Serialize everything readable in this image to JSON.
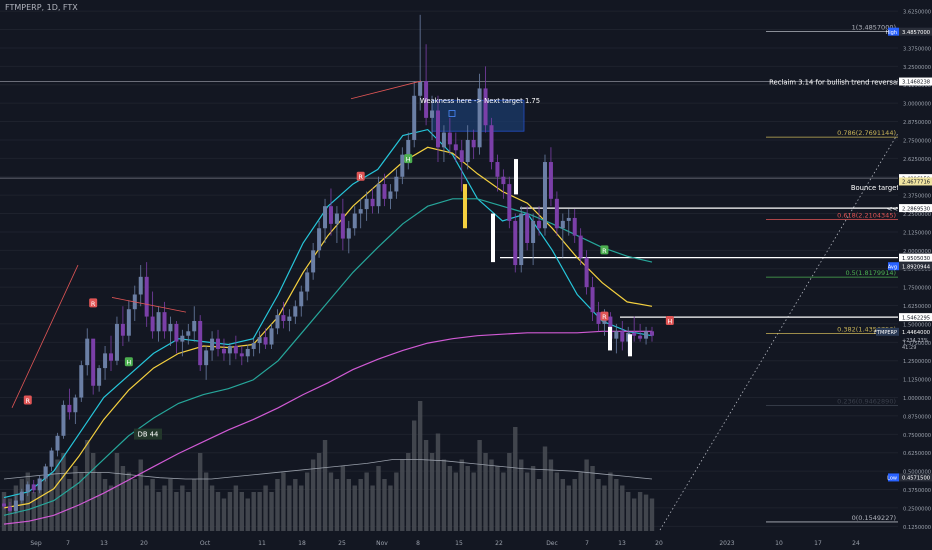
{
  "header": {
    "symbol": "FTMPERP, 1D, FTX"
  },
  "chart_data": {
    "type": "candlestick",
    "symbol": "FTMPERP",
    "interval": "1D",
    "exchange": "FTX",
    "x_labels": [
      "Sep",
      "7",
      "13",
      "20",
      "Oct",
      "11",
      "18",
      "25",
      "Nov",
      "8",
      "15",
      "22",
      "Dec",
      "7",
      "13",
      "20",
      "2023",
      "10",
      "17",
      "24"
    ],
    "y_ticks": [
      "3.6250000",
      "3.5000000",
      "3.3750000",
      "3.2500000",
      "3.1250000",
      "3.0000000",
      "2.8750000",
      "2.7500000",
      "2.6250000",
      "2.5000000",
      "2.3750000",
      "2.2500000",
      "2.1250000",
      "2.0000000",
      "1.8750000",
      "1.7500000",
      "1.6250000",
      "1.5000000",
      "1.3750000",
      "1.2500000",
      "1.1250000",
      "1.0000000",
      "0.8750000",
      "0.7500000",
      "0.6250000",
      "0.5000000",
      "0.3750000",
      "0.2500000",
      "0.1250000"
    ],
    "ylim": [
      0.1,
      3.66
    ],
    "price_tags": [
      {
        "text": "3.4857000",
        "price": 3.4857,
        "color": "#ffffff",
        "bg": "#2a2e39"
      },
      {
        "text": "3.1468238",
        "price": 3.1468,
        "color": "#131722",
        "bg": "#ffffff"
      },
      {
        "text": "2.4906159",
        "price": 2.4906,
        "color": "#131722",
        "bg": "#ffffff"
      },
      {
        "text": "2.4677716",
        "price": 2.4678,
        "color": "#131722",
        "bg": "#f0e4a0"
      },
      {
        "text": "2.2869530",
        "price": 2.287,
        "color": "#131722",
        "bg": "#ffffff"
      },
      {
        "text": "1.9505030",
        "price": 1.9505,
        "color": "#131722",
        "bg": "#ffffff"
      },
      {
        "text": "1.8920944",
        "price": 1.8921,
        "color": "#ffffff",
        "bg": "#2a2e39"
      },
      {
        "text": "1.5462295",
        "price": 1.5462,
        "color": "#131722",
        "bg": "#ffffff"
      },
      {
        "text": "1.4464000",
        "price": 1.4464,
        "color": "#ffffff",
        "bg": "#131722"
      },
      {
        "text": "0.4571500",
        "price": 0.4571,
        "color": "#ffffff",
        "bg": "#2a2e39"
      }
    ],
    "price_tag_labels": [
      {
        "text": "High",
        "price": 3.4857
      },
      {
        "text": "Avg",
        "price": 1.8921
      },
      {
        "text": "FTMPERP",
        "price": 1.4464
      },
      {
        "text": "Low",
        "price": 0.4571
      }
    ],
    "price_tag_subs": [
      "+234.23%",
      "41:29"
    ],
    "fib_levels": [
      {
        "text": "1(3.4857000)",
        "price": 3.4857,
        "color": "#b2b5be"
      },
      {
        "text": "0.786(2.7691144)",
        "price": 2.7691,
        "color": "#c9b458"
      },
      {
        "text": "0.618(2.2104345)",
        "price": 2.2104,
        "color": "#e05555"
      },
      {
        "text": "0.5(1.8179914)",
        "price": 1.818,
        "color": "#4caf50"
      },
      {
        "text": "0.382(1.4356750)",
        "price": 1.4357,
        "color": "#c9b458"
      },
      {
        "text": "0.236(0.9462890)",
        "price": 0.9463,
        "color": "#3a3f4b"
      },
      {
        "text": "0(0.1549227)",
        "price": 0.1549,
        "color": "#b2b5be"
      }
    ],
    "annotations": [
      {
        "text": "Reclaim 3.14 for bullish trend reversal",
        "price": 3.1468
      },
      {
        "text": "Weakness here -> Next target 1.75",
        "price": 3.02
      },
      {
        "text": "Bounce target",
        "price": 2.43
      },
      {
        "text": "<<",
        "price": 2.287
      },
      {
        "text": "DB 44",
        "price": 0.755
      }
    ],
    "candles": [
      [
        0.28,
        0.31,
        0.24,
        0.26
      ],
      [
        0.26,
        0.29,
        0.22,
        0.23
      ],
      [
        0.23,
        0.33,
        0.21,
        0.3
      ],
      [
        0.3,
        0.38,
        0.28,
        0.36
      ],
      [
        0.36,
        0.43,
        0.33,
        0.41
      ],
      [
        0.41,
        0.44,
        0.35,
        0.37
      ],
      [
        0.37,
        0.47,
        0.35,
        0.45
      ],
      [
        0.45,
        0.55,
        0.43,
        0.53
      ],
      [
        0.53,
        0.66,
        0.5,
        0.64
      ],
      [
        0.64,
        0.76,
        0.6,
        0.74
      ],
      [
        0.74,
        0.98,
        0.72,
        0.95
      ],
      [
        0.95,
        1.06,
        0.85,
        0.9
      ],
      [
        0.9,
        1.02,
        0.82,
        1.0
      ],
      [
        1.0,
        1.25,
        0.97,
        1.22
      ],
      [
        1.22,
        1.47,
        1.15,
        1.4
      ],
      [
        1.4,
        1.38,
        1.02,
        1.08
      ],
      [
        1.08,
        1.22,
        1.04,
        1.2
      ],
      [
        1.2,
        1.35,
        1.12,
        1.3
      ],
      [
        1.3,
        1.42,
        1.18,
        1.25
      ],
      [
        1.25,
        1.55,
        1.22,
        1.5
      ],
      [
        1.5,
        1.62,
        1.35,
        1.42
      ],
      [
        1.42,
        1.66,
        1.38,
        1.6
      ],
      [
        1.6,
        1.76,
        1.52,
        1.7
      ],
      [
        1.7,
        1.9,
        1.62,
        1.82
      ],
      [
        1.82,
        1.92,
        1.48,
        1.55
      ],
      [
        1.55,
        1.72,
        1.4,
        1.45
      ],
      [
        1.45,
        1.62,
        1.38,
        1.58
      ],
      [
        1.58,
        1.65,
        1.4,
        1.45
      ],
      [
        1.45,
        1.55,
        1.35,
        1.5
      ],
      [
        1.5,
        1.52,
        1.3,
        1.38
      ],
      [
        1.38,
        1.46,
        1.28,
        1.42
      ],
      [
        1.42,
        1.5,
        1.36,
        1.45
      ],
      [
        1.45,
        1.62,
        1.38,
        1.52
      ],
      [
        1.52,
        1.56,
        1.18,
        1.22
      ],
      [
        1.22,
        1.35,
        1.12,
        1.32
      ],
      [
        1.32,
        1.45,
        1.25,
        1.4
      ],
      [
        1.4,
        1.46,
        1.28,
        1.33
      ],
      [
        1.33,
        1.4,
        1.25,
        1.3
      ],
      [
        1.3,
        1.37,
        1.22,
        1.35
      ],
      [
        1.35,
        1.42,
        1.26,
        1.3
      ],
      [
        1.3,
        1.35,
        1.22,
        1.28
      ],
      [
        1.28,
        1.36,
        1.24,
        1.33
      ],
      [
        1.33,
        1.4,
        1.28,
        1.37
      ],
      [
        1.37,
        1.45,
        1.3,
        1.41
      ],
      [
        1.41,
        1.47,
        1.33,
        1.36
      ],
      [
        1.36,
        1.5,
        1.33,
        1.47
      ],
      [
        1.47,
        1.6,
        1.43,
        1.56
      ],
      [
        1.56,
        1.65,
        1.47,
        1.52
      ],
      [
        1.52,
        1.6,
        1.45,
        1.55
      ],
      [
        1.55,
        1.66,
        1.5,
        1.62
      ],
      [
        1.62,
        1.76,
        1.55,
        1.72
      ],
      [
        1.72,
        1.88,
        1.66,
        1.85
      ],
      [
        1.85,
        2.05,
        1.8,
        2.0
      ],
      [
        2.0,
        2.2,
        1.95,
        2.15
      ],
      [
        2.15,
        2.35,
        2.05,
        2.3
      ],
      [
        2.3,
        2.42,
        2.1,
        2.18
      ],
      [
        2.18,
        2.3,
        2.05,
        2.25
      ],
      [
        2.25,
        2.35,
        2.0,
        2.08
      ],
      [
        2.08,
        2.2,
        1.98,
        2.15
      ],
      [
        2.15,
        2.3,
        2.1,
        2.25
      ],
      [
        2.25,
        2.35,
        2.15,
        2.28
      ],
      [
        2.28,
        2.4,
        2.2,
        2.35
      ],
      [
        2.35,
        2.42,
        2.25,
        2.3
      ],
      [
        2.3,
        2.5,
        2.25,
        2.45
      ],
      [
        2.45,
        2.52,
        2.3,
        2.35
      ],
      [
        2.35,
        2.45,
        2.28,
        2.4
      ],
      [
        2.4,
        2.55,
        2.35,
        2.5
      ],
      [
        2.5,
        2.7,
        2.45,
        2.65
      ],
      [
        2.65,
        2.8,
        2.55,
        2.75
      ],
      [
        2.75,
        3.15,
        2.7,
        3.05
      ],
      [
        3.05,
        3.6,
        2.95,
        3.15
      ],
      [
        3.15,
        3.4,
        2.85,
        2.9
      ],
      [
        2.9,
        3.05,
        2.75,
        2.95
      ],
      [
        2.95,
        3.05,
        2.6,
        2.7
      ],
      [
        2.7,
        2.85,
        2.6,
        2.8
      ],
      [
        2.8,
        2.9,
        2.65,
        2.72
      ],
      [
        2.72,
        2.8,
        2.6,
        2.68
      ],
      [
        2.68,
        2.75,
        2.4,
        2.6
      ],
      [
        2.6,
        2.85,
        2.55,
        2.75
      ],
      [
        2.75,
        2.82,
        2.62,
        2.7
      ],
      [
        2.7,
        3.2,
        2.65,
        3.1
      ],
      [
        3.1,
        3.25,
        2.8,
        2.85
      ],
      [
        2.85,
        2.9,
        2.55,
        2.6
      ],
      [
        2.6,
        2.65,
        2.4,
        2.5
      ],
      [
        2.5,
        2.55,
        2.35,
        2.45
      ],
      [
        2.45,
        2.5,
        2.15,
        2.2
      ],
      [
        2.2,
        2.25,
        1.85,
        1.9
      ],
      [
        1.9,
        2.3,
        1.85,
        2.25
      ],
      [
        2.25,
        2.3,
        2.0,
        2.05
      ],
      [
        2.05,
        2.25,
        1.9,
        2.2
      ],
      [
        2.2,
        2.3,
        2.1,
        2.15
      ],
      [
        2.15,
        2.65,
        2.1,
        2.6
      ],
      [
        2.6,
        2.7,
        2.3,
        2.35
      ],
      [
        2.35,
        2.4,
        2.1,
        2.15
      ],
      [
        2.15,
        2.25,
        1.95,
        2.2
      ],
      [
        2.2,
        2.28,
        2.1,
        2.22
      ],
      [
        2.22,
        2.28,
        2.05,
        2.1
      ],
      [
        2.1,
        2.15,
        1.9,
        1.95
      ],
      [
        1.95,
        2.0,
        1.7,
        1.75
      ],
      [
        1.75,
        1.82,
        1.52,
        1.58
      ],
      [
        1.58,
        1.65,
        1.45,
        1.5
      ],
      [
        1.5,
        1.6,
        1.42,
        1.55
      ],
      [
        1.55,
        1.58,
        1.35,
        1.4
      ],
      [
        1.4,
        1.5,
        1.3,
        1.45
      ],
      [
        1.45,
        1.52,
        1.32,
        1.38
      ],
      [
        1.38,
        1.48,
        1.3,
        1.44
      ],
      [
        1.44,
        1.55,
        1.38,
        1.42
      ],
      [
        1.42,
        1.5,
        1.38,
        1.4
      ],
      [
        1.4,
        1.48,
        1.36,
        1.45
      ],
      [
        1.45,
        1.48,
        1.38,
        1.42
      ]
    ],
    "series": [
      {
        "name": "ma-cyan",
        "color": "#26c6da",
        "values": [
          0.32,
          0.36,
          0.5,
          0.75,
          1.0,
          1.15,
          1.3,
          1.4,
          1.38,
          1.36,
          1.4,
          1.7,
          2.05,
          2.3,
          2.45,
          2.55,
          2.78,
          2.82,
          2.65,
          2.35,
          2.2,
          2.25,
          2.0,
          1.7,
          1.52,
          1.45,
          1.42
        ]
      },
      {
        "name": "ma-yellow",
        "color": "#f4d03f",
        "values": [
          0.25,
          0.28,
          0.38,
          0.6,
          0.85,
          1.05,
          1.2,
          1.3,
          1.35,
          1.34,
          1.36,
          1.55,
          1.85,
          2.1,
          2.3,
          2.45,
          2.6,
          2.7,
          2.66,
          2.52,
          2.4,
          2.32,
          2.15,
          1.95,
          1.78,
          1.65,
          1.62
        ]
      },
      {
        "name": "ema-green",
        "color": "#26a69a",
        "values": [
          0.2,
          0.24,
          0.3,
          0.42,
          0.58,
          0.74,
          0.86,
          0.96,
          1.02,
          1.06,
          1.12,
          1.25,
          1.45,
          1.65,
          1.85,
          2.02,
          2.18,
          2.3,
          2.35,
          2.35,
          2.3,
          2.25,
          2.18,
          2.1,
          2.02,
          1.96,
          1.92
        ]
      },
      {
        "name": "ma-magenta",
        "color": "#d05ad4",
        "values": [
          0.14,
          0.16,
          0.2,
          0.27,
          0.35,
          0.44,
          0.53,
          0.62,
          0.7,
          0.78,
          0.85,
          0.93,
          1.02,
          1.1,
          1.19,
          1.26,
          1.32,
          1.37,
          1.4,
          1.42,
          1.43,
          1.44,
          1.44,
          1.44,
          1.45,
          1.45,
          1.45
        ]
      }
    ],
    "volume": [
      30,
      25,
      35,
      40,
      45,
      30,
      40,
      50,
      45,
      55,
      60,
      40,
      50,
      45,
      70,
      60,
      45,
      40,
      35,
      60,
      50,
      45,
      40,
      55,
      35,
      40,
      30,
      35,
      40,
      30,
      35,
      30,
      40,
      60,
      45,
      35,
      30,
      25,
      30,
      35,
      30,
      25,
      30,
      30,
      35,
      30,
      40,
      45,
      35,
      40,
      35,
      45,
      55,
      60,
      70,
      45,
      40,
      50,
      40,
      35,
      40,
      45,
      35,
      50,
      40,
      35,
      45,
      55,
      60,
      85,
      100,
      70,
      60,
      75,
      55,
      50,
      45,
      55,
      50,
      45,
      70,
      60,
      55,
      50,
      45,
      60,
      80,
      55,
      45,
      50,
      40,
      65,
      55,
      45,
      40,
      35,
      40,
      45,
      55,
      50,
      40,
      35,
      45,
      40,
      35,
      30,
      25,
      30,
      28,
      25
    ],
    "volume_ma": [
      40,
      42,
      44,
      45,
      45,
      43,
      41,
      40,
      40,
      42,
      44,
      46,
      48,
      50,
      52,
      55,
      55,
      54,
      52,
      50,
      48,
      47,
      46,
      44,
      42,
      40
    ],
    "markers": [
      {
        "text": "R",
        "i": 4,
        "price": 0.98,
        "box": "#e05555"
      },
      {
        "text": "R",
        "i": 15,
        "price": 1.64,
        "box": "#e05555"
      },
      {
        "text": "H",
        "i": 21,
        "price": 1.24,
        "box": "#4caf50"
      },
      {
        "text": "H",
        "i": 68,
        "price": 2.62,
        "box": "#4caf50"
      },
      {
        "text": "R",
        "i": 60,
        "price": 2.5,
        "box": "#e05555"
      },
      {
        "text": "R",
        "i": 101,
        "price": 1.55,
        "box": "#e05555"
      },
      {
        "text": "H",
        "i": 112,
        "price": 1.52,
        "box": "#e05555"
      },
      {
        "text": "R",
        "i": 101,
        "price": 2.0,
        "box": "#4caf50"
      }
    ]
  }
}
